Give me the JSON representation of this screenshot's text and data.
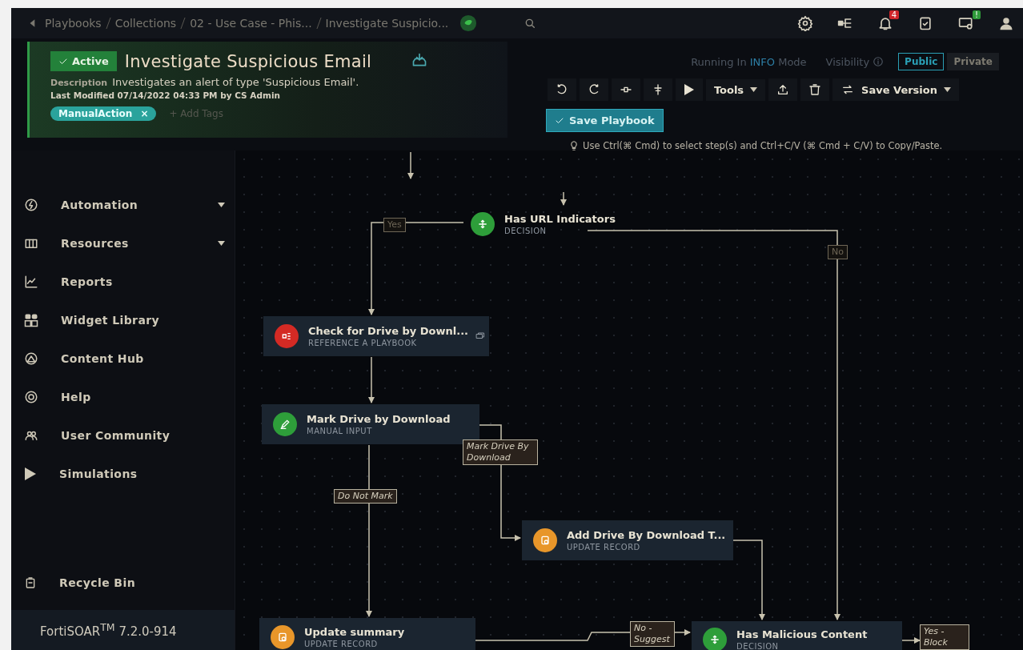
{
  "breadcrumb": [
    "Playbooks",
    "Collections",
    "02 - Use Case - Phis...",
    "Investigate Suspicio..."
  ],
  "topbar": {
    "notification_count": "4",
    "alert_badge": "!"
  },
  "playbook": {
    "status": "Active",
    "title": "Investigate Suspicious Email",
    "description_label": "Description",
    "description": "Investigates an alert of type 'Suspicious Email'.",
    "last_modified": "Last Modified 07/14/2022 04:33 PM by CS Admin",
    "tags": [
      "ManualAction"
    ],
    "tag_remove": "×",
    "add_tags": "+ Add Tags"
  },
  "mode": {
    "prefix": "Running In",
    "level": "INFO",
    "suffix": "Mode"
  },
  "visibility": {
    "label": "Visibility",
    "options": [
      {
        "label": "Public",
        "selected": true
      },
      {
        "label": "Private",
        "selected": false
      }
    ]
  },
  "toolbar": {
    "tools": "Tools",
    "save_version": "Save Version",
    "save_playbook": "Save Playbook",
    "hint": "Use Ctrl(⌘ Cmd) to select step(s) and Ctrl+C/V (⌘ Cmd + C/V) to Copy/Paste."
  },
  "sidebar": {
    "items": [
      {
        "label": "Automation",
        "kind": "group"
      },
      {
        "label": "Resources",
        "kind": "group"
      },
      {
        "label": "Reports",
        "kind": "link"
      },
      {
        "label": "Widget Library",
        "kind": "link"
      },
      {
        "label": "Content Hub",
        "kind": "link"
      },
      {
        "label": "Help",
        "kind": "link"
      },
      {
        "label": "User Community",
        "kind": "link"
      },
      {
        "label": "Simulations",
        "kind": "link"
      }
    ],
    "recycle_bin": "Recycle Bin",
    "version": "FortiSOAR$^{TM}$ 7.2.0-914"
  },
  "steps": [
    {
      "title": "Has URL Indicators",
      "type": "DECISION",
      "kind": "decision",
      "color": "#2e9e3a"
    },
    {
      "title": "Check for Drive by Downl...",
      "type": "REFERENCE A PLAYBOOK",
      "kind": "reference",
      "color": "#d42a24"
    },
    {
      "title": "Mark Drive by Download",
      "type": "MANUAL INPUT",
      "kind": "manual",
      "color": "#2e9e3a"
    },
    {
      "title": "Add Drive By Download T...",
      "type": "UPDATE RECORD",
      "kind": "update",
      "color": "#e8962a"
    },
    {
      "title": "Update summary",
      "type": "UPDATE RECORD",
      "kind": "update",
      "color": "#e8962a"
    },
    {
      "title": "Has Malicious Content",
      "type": "DECISION",
      "kind": "decision",
      "color": "#2e9e3a"
    }
  ],
  "edge_labels": [
    "Yes",
    "No",
    "Mark Drive By Download",
    "Do Not Mark",
    "No - Suggest",
    "Yes - Block"
  ]
}
